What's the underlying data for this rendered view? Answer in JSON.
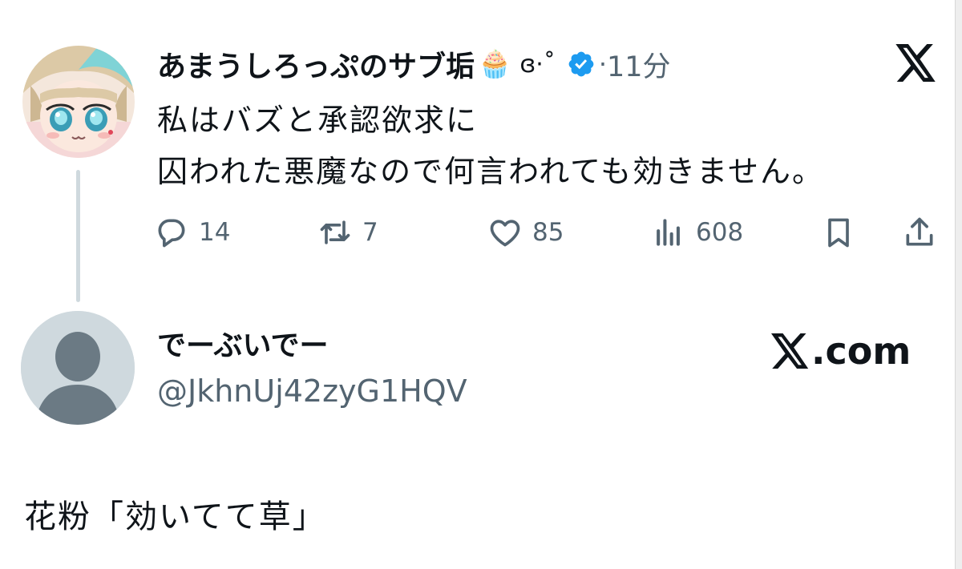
{
  "quoted_tweet": {
    "display_name": "あまうしろっぷのサブ垢",
    "name_emoji": "🧁",
    "name_decoration": "ɞ·˚",
    "verified_icon": "verified-badge-icon",
    "separator": "·",
    "timestamp": "11分",
    "body_lines": [
      "私はバズと承認欲求に",
      "囚われた悪魔なので何言われても効きません。"
    ],
    "actions": {
      "reply_count": "14",
      "retweet_count": "7",
      "like_count": "85",
      "views_count": "608"
    },
    "colors": {
      "verified": "#1d9bf0",
      "muted_text": "#536471",
      "thread_line": "#cfd9de"
    }
  },
  "card": {
    "display_name": "でーぶいでー",
    "handle": "@JkhnUj42zyG1HQV",
    "site_label": ".com",
    "caption": "花粉「効いてて草」"
  }
}
